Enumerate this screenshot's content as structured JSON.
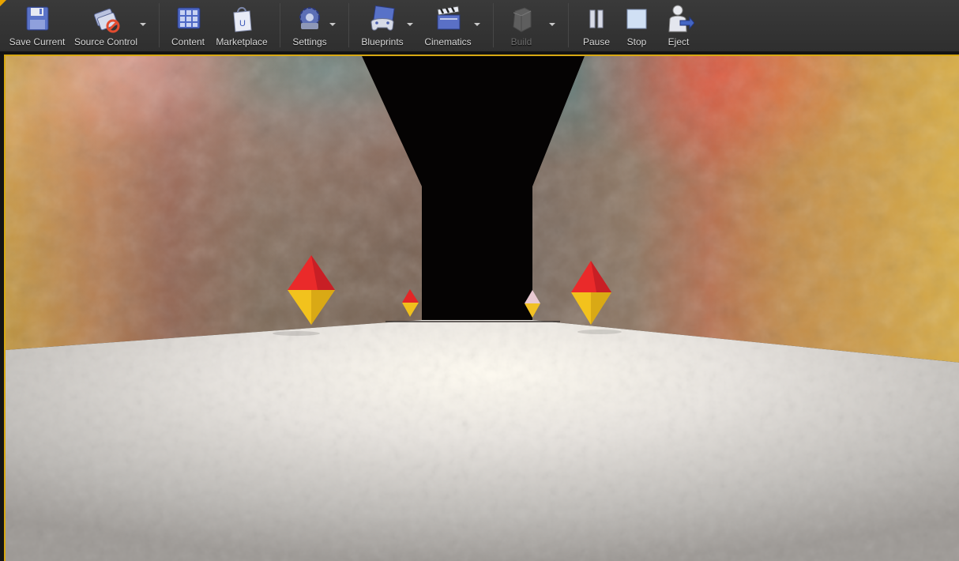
{
  "toolbar": {
    "buttons": [
      {
        "label": "Save Current",
        "icon": "floppy-disk-icon"
      },
      {
        "label": "Source Control",
        "icon": "source-control-disabled-icon"
      },
      {
        "label": "Content",
        "icon": "content-browser-icon"
      },
      {
        "label": "Marketplace",
        "icon": "marketplace-bag-icon"
      },
      {
        "label": "Settings",
        "icon": "gears-icon"
      },
      {
        "label": "Blueprints",
        "icon": "gamepad-blueprint-icon"
      },
      {
        "label": "Cinematics",
        "icon": "clapperboard-icon"
      },
      {
        "label": "Build",
        "icon": "build-blocks-icon",
        "disabled": true
      },
      {
        "label": "Pause",
        "icon": "pause-icon"
      },
      {
        "label": "Stop",
        "icon": "stop-icon"
      },
      {
        "label": "Eject",
        "icon": "eject-person-icon"
      }
    ]
  },
  "viewport": {
    "border_color": "#d7a812",
    "scene": "corridor with two textured walls, dark opening and four red-yellow diamond pickups"
  },
  "colors": {
    "toolbar_bg": "#343434",
    "accent": "#d7a812",
    "pickup_top": "#e8262b",
    "pickup_bottom": "#f2c21b"
  }
}
